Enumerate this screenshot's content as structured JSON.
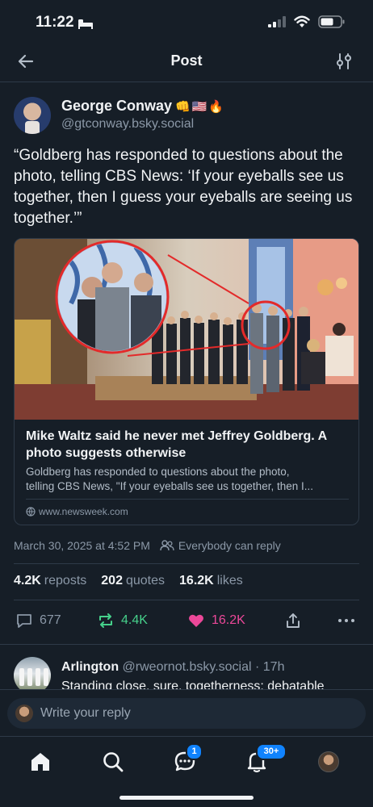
{
  "status_bar": {
    "time": "11:22"
  },
  "nav": {
    "title": "Post"
  },
  "post": {
    "author_name": "George Conway",
    "author_emoji": "👊🇺🇸🔥",
    "author_handle": "@gtconway.bsky.social",
    "text": "“Goldberg has responded to questions about the photo, telling CBS News: ‘If your eyeballs see us together, then I guess your eyeballs are seeing us together.’”",
    "link_card": {
      "headline": "Mike Waltz said he never met Jeffrey Goldberg. A photo suggests otherwise",
      "description_line1": "Goldberg has responded to questions about the photo,",
      "description_line2": "telling CBS News, \"If your eyeballs see us together, then I...",
      "domain": "www.newsweek.com"
    },
    "timestamp": "March 30, 2025 at 4:52 PM",
    "visibility": "Everybody can reply",
    "stats": {
      "reposts_count": "4.2K",
      "reposts_label": "reposts",
      "quotes_count": "202",
      "quotes_label": "quotes",
      "likes_count": "16.2K",
      "likes_label": "likes"
    },
    "actions": {
      "replies": "677",
      "reposts": "4.4K",
      "likes": "16.2K"
    }
  },
  "reply_preview": {
    "name": "Arlington",
    "handle": "@rweornot.bsky.social",
    "age": "· 17h",
    "text": "Standing close, sure, togetherness; debatable"
  },
  "composer": {
    "placeholder": "Write your reply"
  },
  "tabbar": {
    "messages_badge": "1",
    "notifications_badge": "30+"
  },
  "colors": {
    "background": "#161e27",
    "repost_active": "#46d18b",
    "like_active": "#ec4899",
    "badge": "#1083fe"
  },
  "icons": [
    "back-arrow-icon",
    "filter-icon",
    "globe-icon",
    "people-icon",
    "reply-icon",
    "repost-icon",
    "heart-icon",
    "share-icon",
    "more-icon",
    "home-icon",
    "search-icon",
    "chat-icon",
    "bell-icon"
  ]
}
